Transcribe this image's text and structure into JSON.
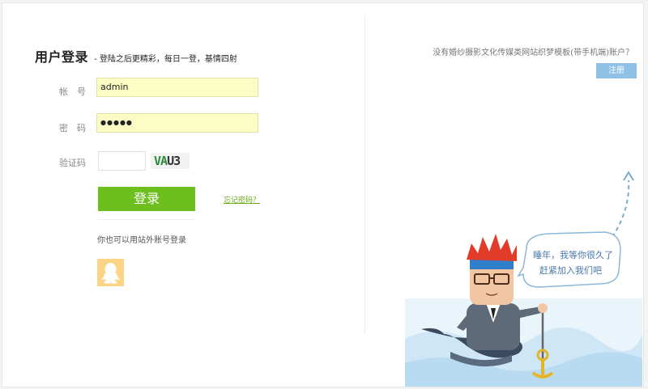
{
  "login": {
    "title": "用户登录",
    "subtitle": "- 登陆之后更精彩，每日一登，基情四射",
    "username_label": "帐　号",
    "username_value": "admin",
    "password_label": "密　码",
    "password_value": "●●●●●",
    "captcha_label": "验证码",
    "captcha_value": "",
    "captcha_chars_a": "VA",
    "captcha_chars_b": "U3",
    "submit_label": "登录",
    "forgot_label": "忘记密码？",
    "other_login_label": "你也可以用站外账号登录"
  },
  "register": {
    "prompt": "没有婚纱摄影文化传媒类网站织梦模板(带手机端)账户？",
    "button_label": "注册"
  },
  "illustration": {
    "speech_line1": "睡年，我等你很久了",
    "speech_line2": "赶紧加入我们吧"
  },
  "colors": {
    "accent_green": "#6cbf1d",
    "register_blue": "#8fc1e6",
    "input_yellow": "#fbfdc5",
    "qq_yellow": "#fcd488"
  },
  "icons": {
    "social": "qq-icon",
    "arrow": "dashed-arrow-icon"
  }
}
